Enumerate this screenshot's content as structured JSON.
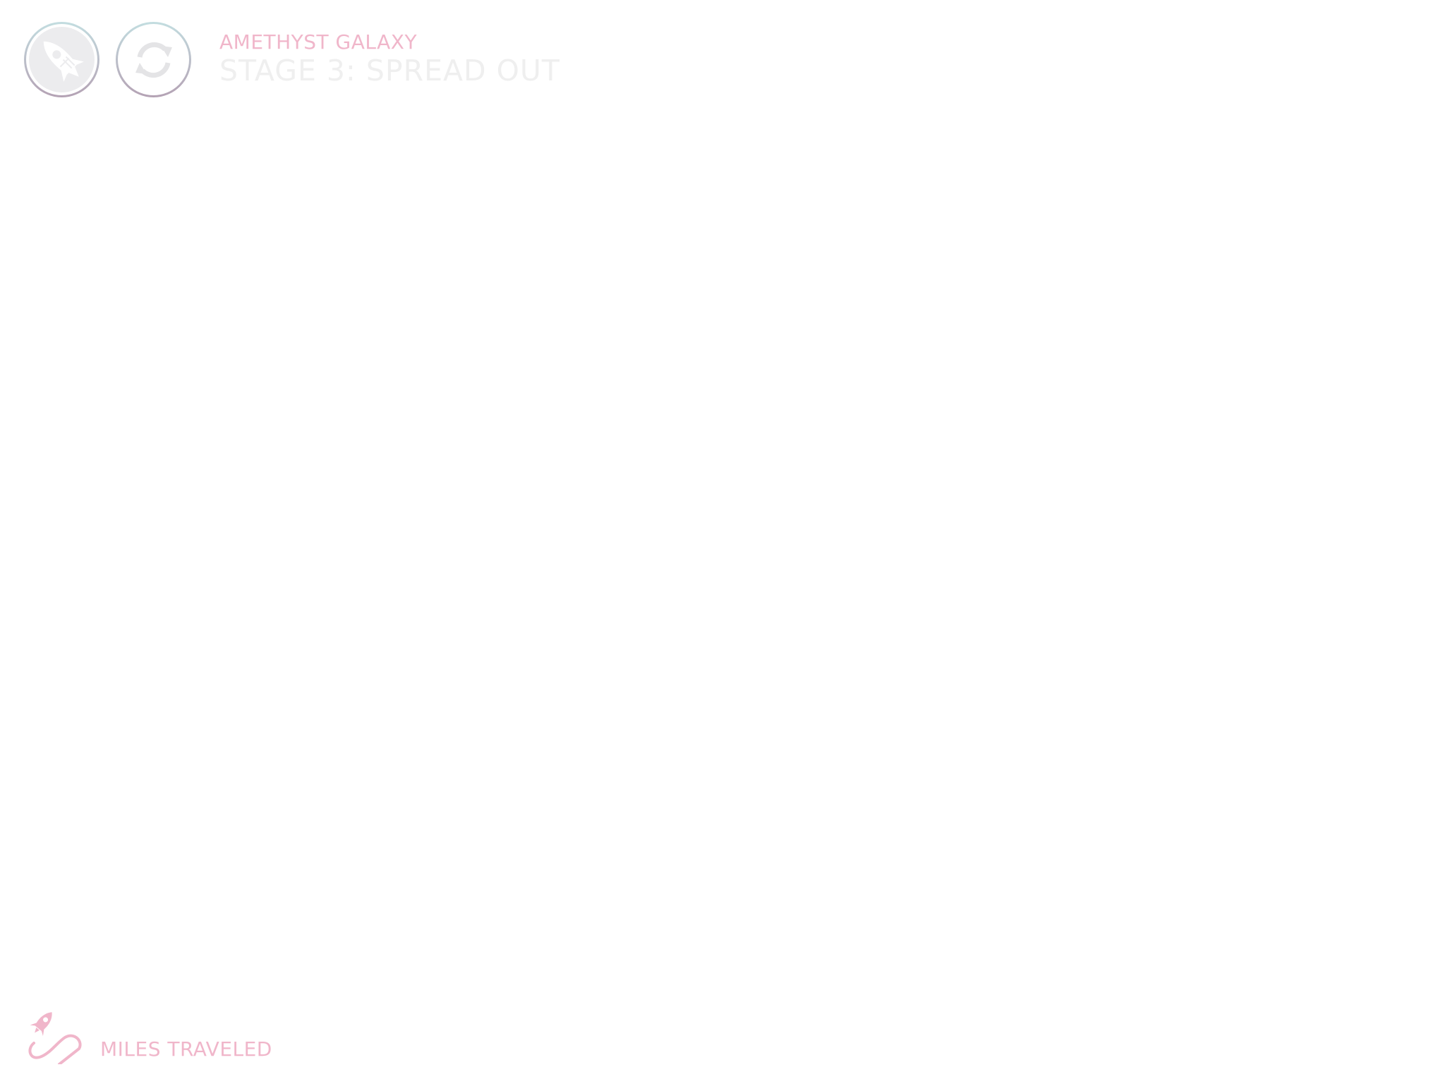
{
  "header": {
    "galaxy_name": "AMETHYST GALAXY",
    "stage_title": "STAGE 3: SPREAD OUT"
  },
  "buttons": {
    "ship": {
      "icon": "rocket-icon"
    },
    "restart": {
      "icon": "refresh-icon"
    }
  },
  "footer": {
    "icon": "rocket-trail-icon",
    "miles_label": "MILES TRAVELED"
  },
  "colors": {
    "accent_pink": "#f0b6ca",
    "muted_gray": "#efefef",
    "ring_top": "#c3dde0",
    "ring_bottom": "#b4a2b4",
    "background": "#ffffff"
  }
}
